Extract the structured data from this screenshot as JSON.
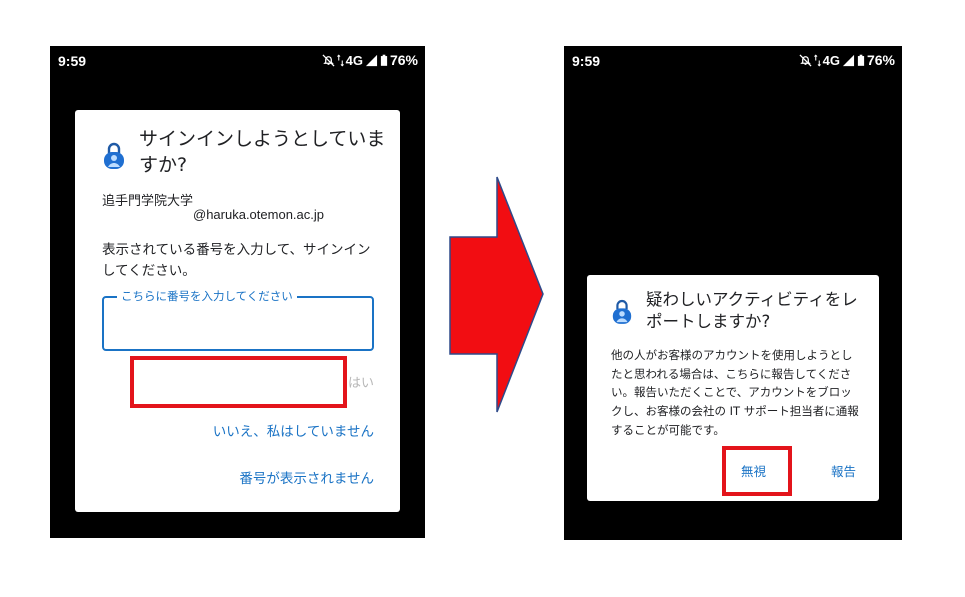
{
  "left_screen": {
    "status": {
      "time": "9:59",
      "network": "4G",
      "battery": "76%"
    },
    "dialog": {
      "title": "サインインしようとしていますか?",
      "organization": "追手門学院大学",
      "email": "@haruka.otemon.ac.jp",
      "instruction": "表示されている番号を入力して、サインインしてください。",
      "input_label": "こちらに番号を入力してください",
      "input_value": "",
      "yes_label": "はい",
      "no_label": "いいえ、私はしていません",
      "no_number_label": "番号が表示されません"
    }
  },
  "right_screen": {
    "status": {
      "time": "9:59",
      "network": "4G",
      "battery": "76%"
    },
    "dialog": {
      "title": "疑わしいアクティビティをレポートしますか?",
      "body": "他の人がお客様のアカウントを使用しようとしたと思われる場合は、こちらに報告してください。報告いただくことで、アカウントをブロックし、お客様の会社の IT サポート担当者に通報することが可能です。",
      "ignore_label": "無視",
      "report_label": "報告"
    }
  },
  "colors": {
    "accent": "#1a73c5",
    "highlight": "#e3141b",
    "disabled": "#b8b8b8",
    "screen_bg": "#000000"
  },
  "icons": [
    "authenticator-lock-icon",
    "mute-icon",
    "data-arrows-icon",
    "signal-icon",
    "battery-icon",
    "right-arrow-icon"
  ]
}
